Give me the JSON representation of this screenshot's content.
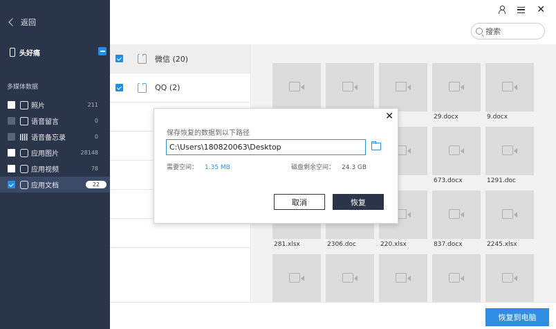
{
  "sidebar": {
    "back_label": "返回",
    "device_name": "头好痛",
    "section_title": "多媒体数据",
    "items": [
      {
        "label": "照片",
        "count": "211"
      },
      {
        "label": "语音留言",
        "count": "0"
      },
      {
        "label": "语音备忘录",
        "count": "0"
      },
      {
        "label": "应用图片",
        "count": "28148"
      },
      {
        "label": "应用视频",
        "count": "78"
      },
      {
        "label": "应用文档",
        "count": "22"
      }
    ]
  },
  "header": {
    "search_placeholder": "搜索"
  },
  "sources": [
    {
      "label": "微信 (20)"
    },
    {
      "label": "QQ (2)"
    }
  ],
  "files": [
    "",
    "",
    "",
    "29.docx",
    "9.docx",
    "",
    "",
    "",
    "673.docx",
    "1291.doc",
    "281.xlsx",
    "2306.doc",
    "220.xlsx",
    "837.docx",
    "2245.xlsx",
    "",
    "",
    "",
    "",
    ""
  ],
  "dialog": {
    "title": "保存恢复的数据到以下路径",
    "path": "C:\\Users\\180820063\\Desktop",
    "required_label": "需要空间：",
    "required_value": "1.35 MB",
    "free_label": "磁盘剩余空间：",
    "free_value": "24.3 GB",
    "cancel_label": "取消",
    "restore_label": "恢复"
  },
  "footer": {
    "recover_to_pc_label": "恢复到电脑"
  },
  "colors": {
    "sidebar_bg": "#2b3549",
    "accent": "#2f8ee3"
  }
}
